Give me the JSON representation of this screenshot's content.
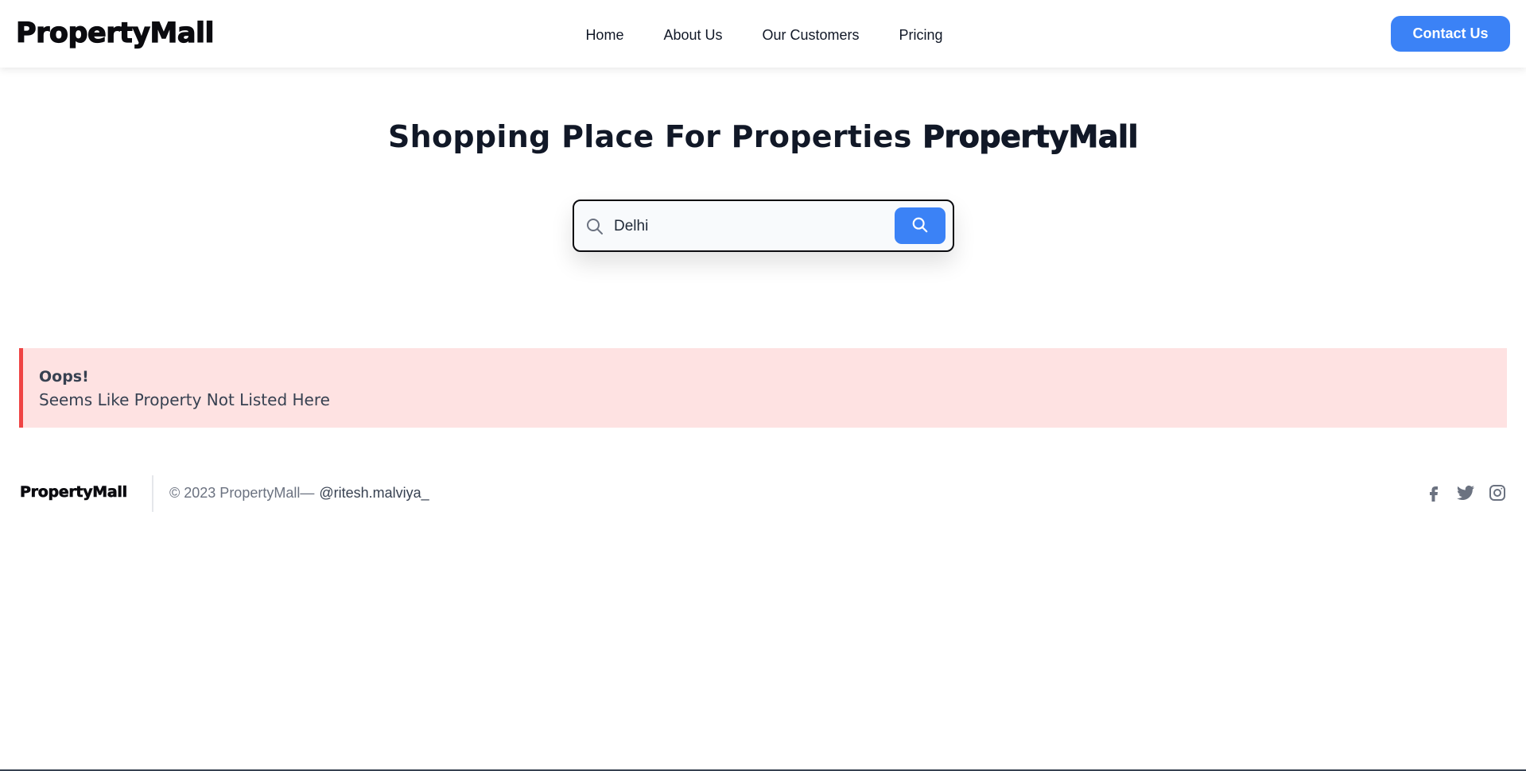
{
  "header": {
    "logo": "PropertyMall",
    "nav": [
      "Home",
      "About Us",
      "Our Customers",
      "Pricing"
    ],
    "contact_label": "Contact Us"
  },
  "hero": {
    "title_prefix": "Shopping Place For Properties",
    "title_brand": "PropertyMall"
  },
  "search": {
    "value": "Delhi",
    "icon": "search-icon",
    "button_icon": "search-icon"
  },
  "alert": {
    "title": "Oops!",
    "message": "Seems Like Property Not Listed Here",
    "color_bg": "#fee2e2",
    "color_border": "#ef4444"
  },
  "footer": {
    "logo": "PropertyMall",
    "copyright": "© 2023 PropertyMall—",
    "handle": "@ritesh.malviya_",
    "socials": [
      "facebook-icon",
      "twitter-icon",
      "instagram-icon"
    ]
  },
  "colors": {
    "accent": "#3b82f6",
    "text": "#111827"
  }
}
